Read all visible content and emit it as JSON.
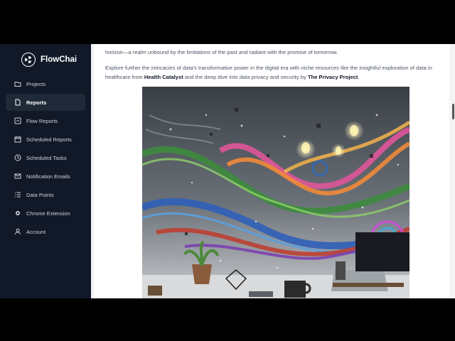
{
  "app": {
    "name": "FlowChai"
  },
  "sidebar": {
    "items": [
      {
        "label": "Projects",
        "icon": "folder-icon",
        "active": false
      },
      {
        "label": "Reports",
        "icon": "file-icon",
        "active": true
      },
      {
        "label": "Flow Reports",
        "icon": "flow-icon",
        "active": false
      },
      {
        "label": "Scheduled Reports",
        "icon": "calendar-icon",
        "active": false
      },
      {
        "label": "Scheduled Tasks",
        "icon": "clock-icon",
        "active": false
      },
      {
        "label": "Notification Emails",
        "icon": "mail-icon",
        "active": false
      },
      {
        "label": "Data Points",
        "icon": "list-icon",
        "active": false
      },
      {
        "label": "Chrome Extension",
        "icon": "chrome-icon",
        "active": false
      },
      {
        "label": "Account",
        "icon": "user-icon",
        "active": false
      }
    ]
  },
  "article": {
    "p1": "horizon—a realm unbound by the limitations of the past and radiant with the promise of tomorrow.",
    "p2_before": "Explore further the intricacies of data's transformative power in the digital era with niche resources like the insightful exploration of data in healthcare from ",
    "link1": "Health Catalyst",
    "p2_middle": " and the deep dive into data privacy and security by ",
    "link2": "The Privacy Project",
    "p2_after": "."
  },
  "colors": {
    "sidebar_bg": "#111827",
    "active_item_bg": "#1f2937",
    "content_bg": "#ffffff",
    "page_bg": "#f3f4f6"
  }
}
